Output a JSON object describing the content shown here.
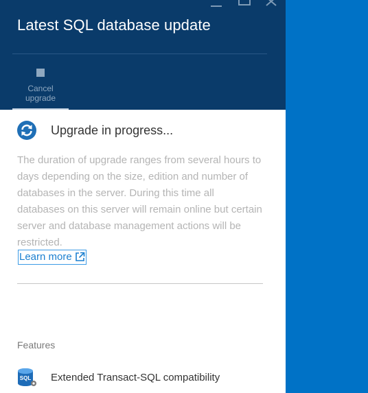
{
  "blade": {
    "title": "Latest SQL database update",
    "command": {
      "label": "Cancel upgrade",
      "icon": "stop-icon"
    },
    "window_controls": [
      "minimize-icon",
      "maximize-icon",
      "close-icon"
    ]
  },
  "status": {
    "icon": "sync-icon",
    "text": "Upgrade in progress...",
    "description": "The duration of upgrade ranges from several hours to days depending on the size, edition and number of databases in the server. During this time all databases on this server will remain online but certain server and database management actions will be restricted.",
    "learn_more": "Learn more"
  },
  "features": {
    "heading": "Features",
    "items": [
      {
        "icon": "sql-database-icon",
        "label": "Extended Transact-SQL compatibility"
      }
    ]
  },
  "colors": {
    "header_bg": "#0A3B6A",
    "background_blue": "#0072C6",
    "accent": "#1A7FD0"
  }
}
